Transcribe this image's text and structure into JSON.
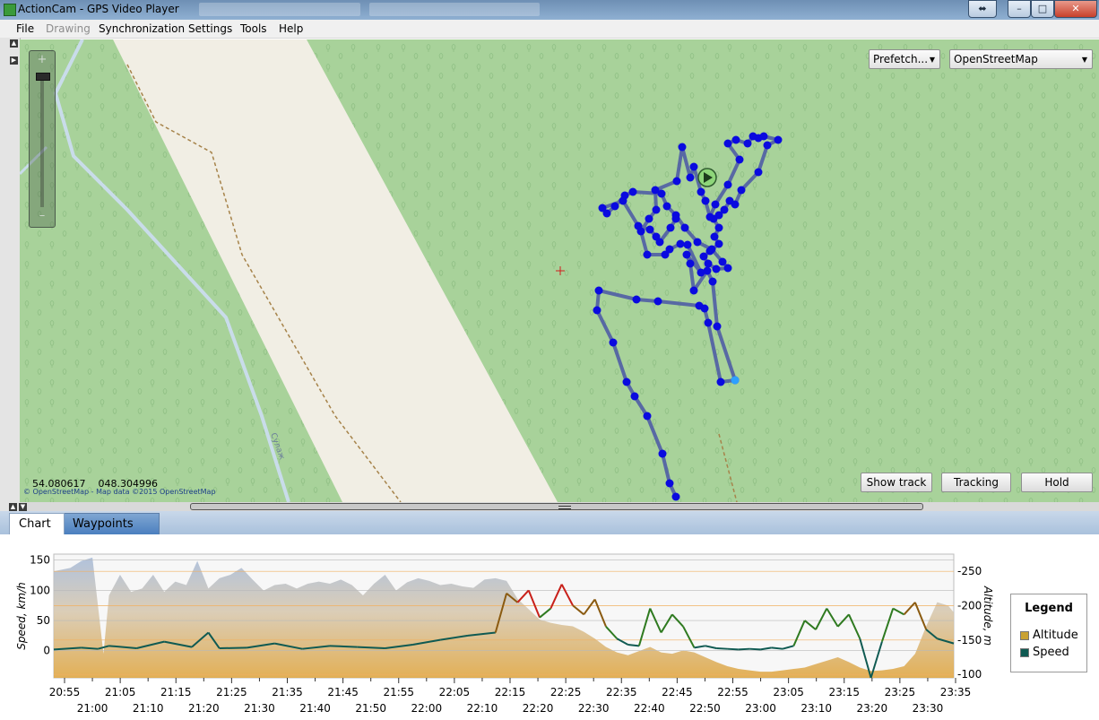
{
  "window": {
    "title": "ActionCam - GPS Video Player",
    "buttons": {
      "resize": "⬌",
      "minimize": "–",
      "maximize": "□",
      "close": "✕"
    }
  },
  "menu": {
    "items": [
      {
        "label": "File",
        "enabled": true
      },
      {
        "label": "Drawing",
        "enabled": false
      },
      {
        "label": "Synchronization",
        "enabled": true
      },
      {
        "label": "Settings",
        "enabled": true
      },
      {
        "label": "Tools",
        "enabled": true
      },
      {
        "label": "Help",
        "enabled": true
      }
    ]
  },
  "map": {
    "zoom_plus": "+",
    "zoom_minus": "–",
    "prefetch_select": "Prefetch...",
    "provider_select": "OpenStreetMap",
    "coords_lat": "54.080617",
    "coords_lon": "048.304996",
    "attribution": "© OpenStreetMap - Map data ©2015 OpenStreetMap",
    "road_label": "Сулаж",
    "buttons": {
      "show_track": "Show track",
      "tracking": "Tracking",
      "hold": "Hold"
    },
    "colors": {
      "forest": "#a8d29a",
      "clearing": "#f1eee4",
      "track_line": "#4a57a6",
      "track_point": "#0a0adf",
      "start_point": "#2ea0ff"
    }
  },
  "tabs": {
    "chart": "Chart",
    "waypoints": "Waypoints"
  },
  "chart_data": {
    "type": "area",
    "ylabel": "Speed, km/h",
    "y2label": "Altitude, m",
    "yticks": [
      "150",
      "100",
      "50",
      "0"
    ],
    "y2ticks": [
      "250",
      "200",
      "150",
      "100"
    ],
    "ylim": [
      -45,
      160
    ],
    "y2lim": [
      95,
      275
    ],
    "xticks_top": [
      "20:55",
      "21:05",
      "21:15",
      "21:25",
      "21:35",
      "21:45",
      "21:55",
      "22:05",
      "22:15",
      "22:25",
      "22:35",
      "22:45",
      "22:55",
      "23:05",
      "23:15",
      "23:25",
      "23:35"
    ],
    "xticks_bottom": [
      "21:00",
      "21:10",
      "21:20",
      "21:30",
      "21:40",
      "21:50",
      "22:00",
      "22:10",
      "22:20",
      "22:30",
      "22:40",
      "22:50",
      "23:00",
      "23:10",
      "23:20",
      "23:30"
    ],
    "legend_title": "Legend",
    "series": [
      {
        "name": "Altitude",
        "color": "#c9a233",
        "x": [
          0,
          3,
          5,
          7,
          9,
          10,
          12,
          14,
          16,
          18,
          20,
          22,
          24,
          26,
          28,
          30,
          32,
          34,
          36,
          38,
          40,
          42,
          44,
          46,
          48,
          50,
          52,
          54,
          56,
          58,
          60,
          62,
          64,
          66,
          68,
          70,
          72,
          74,
          76,
          78,
          80,
          82,
          84,
          86,
          88,
          90,
          92,
          94,
          96,
          98,
          100,
          102,
          104,
          106,
          108,
          110,
          112,
          114,
          116,
          118,
          120,
          122,
          124,
          126,
          128,
          130,
          132,
          134,
          136,
          138,
          140,
          142,
          144,
          146,
          148,
          150,
          152,
          154,
          156,
          158,
          160,
          162,
          163
        ],
        "values": [
          250,
          255,
          265,
          270,
          130,
          215,
          245,
          220,
          225,
          245,
          220,
          235,
          230,
          265,
          225,
          240,
          245,
          255,
          238,
          222,
          230,
          232,
          225,
          232,
          235,
          232,
          238,
          230,
          215,
          232,
          245,
          222,
          234,
          240,
          236,
          230,
          232,
          228,
          226,
          238,
          240,
          236,
          210,
          195,
          180,
          175,
          172,
          170,
          162,
          152,
          140,
          132,
          128,
          134,
          140,
          132,
          130,
          135,
          132,
          125,
          118,
          112,
          108,
          106,
          104,
          104,
          106,
          108,
          110,
          115,
          120,
          125,
          118,
          110,
          105,
          106,
          108,
          112,
          130,
          170,
          205,
          200,
          190
        ]
      },
      {
        "name": "Speed",
        "color": "#0f5a52",
        "x": [
          0,
          5,
          8,
          10,
          15,
          20,
          25,
          28,
          30,
          35,
          40,
          45,
          50,
          55,
          60,
          65,
          70,
          75,
          80,
          82,
          84,
          86,
          88,
          90,
          92,
          94,
          96,
          98,
          100,
          102,
          104,
          106,
          108,
          110,
          112,
          114,
          116,
          118,
          120,
          122,
          124,
          126,
          128,
          130,
          132,
          134,
          136,
          138,
          140,
          142,
          144,
          146,
          148,
          150,
          152,
          154,
          156,
          158,
          160,
          163
        ],
        "values": [
          2,
          5,
          3,
          8,
          4,
          15,
          6,
          30,
          4,
          5,
          12,
          3,
          8,
          6,
          4,
          10,
          18,
          25,
          30,
          95,
          80,
          100,
          55,
          70,
          110,
          75,
          60,
          85,
          40,
          20,
          10,
          8,
          70,
          30,
          60,
          40,
          5,
          8,
          4,
          3,
          2,
          3,
          2,
          5,
          3,
          8,
          50,
          35,
          70,
          40,
          60,
          20,
          -45,
          15,
          70,
          60,
          80,
          35,
          20,
          12
        ]
      }
    ]
  }
}
